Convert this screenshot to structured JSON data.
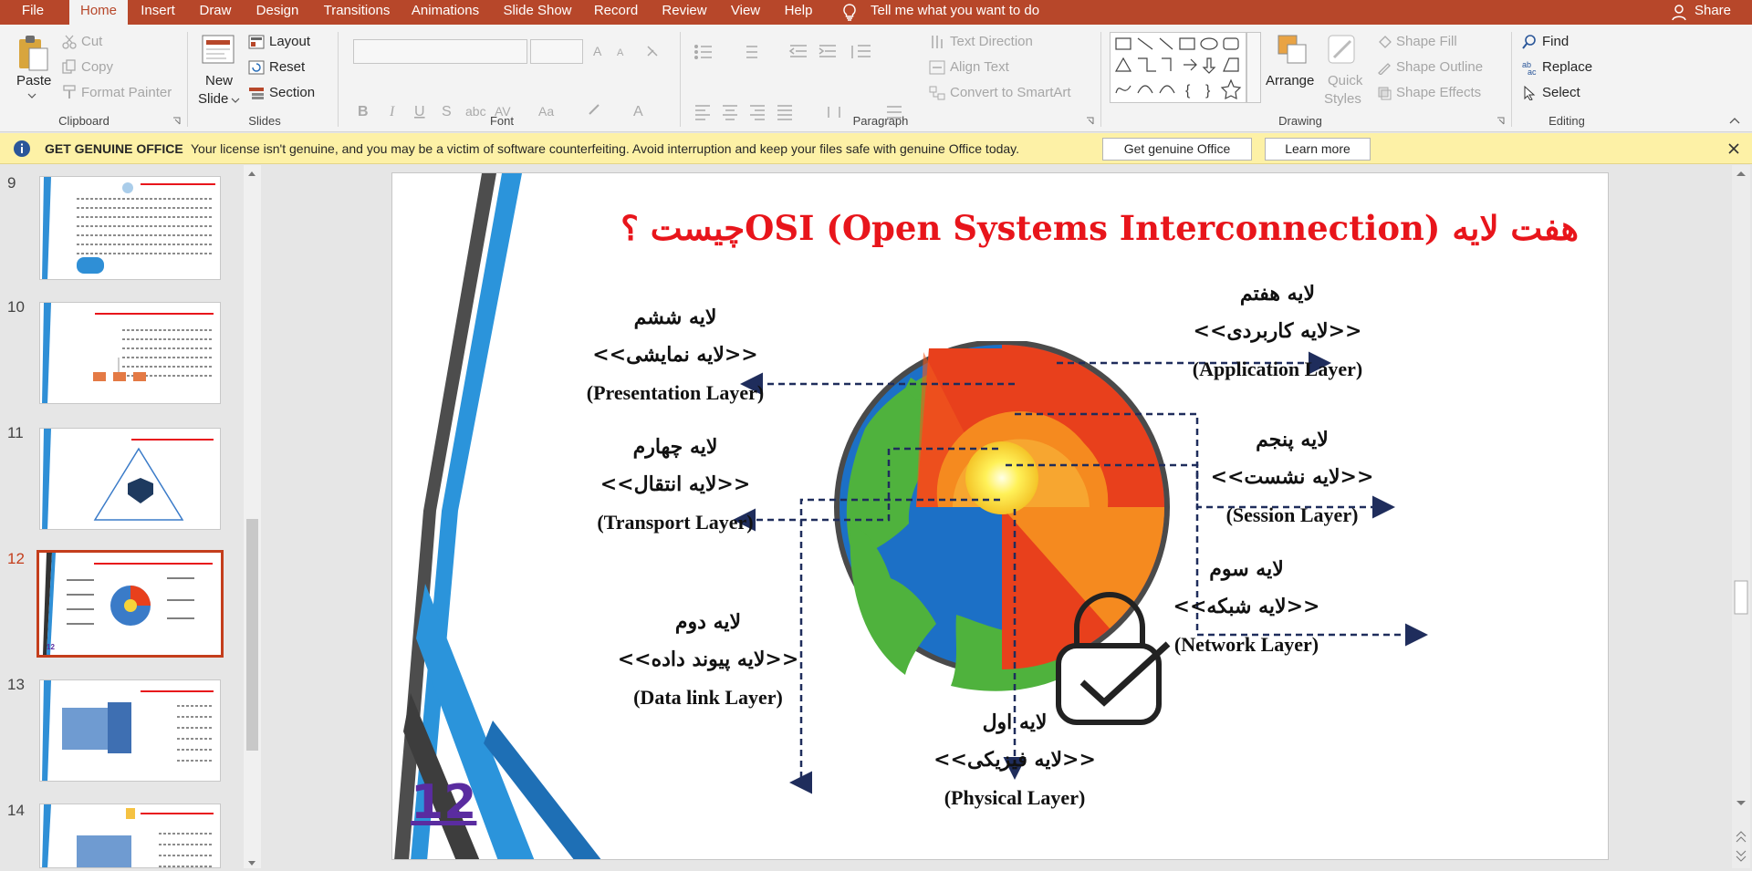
{
  "tabs": [
    "File",
    "Home",
    "Insert",
    "Draw",
    "Design",
    "Transitions",
    "Animations",
    "Slide Show",
    "Record",
    "Review",
    "View",
    "Help"
  ],
  "tell_me": "Tell me what you want to do",
  "share": "Share",
  "clipboard": {
    "paste": "Paste",
    "cut": "Cut",
    "copy": "Copy",
    "format_painter": "Format Painter",
    "label": "Clipboard"
  },
  "slides_grp": {
    "new_slide_1": "New",
    "new_slide_2": "Slide",
    "layout": "Layout",
    "reset": "Reset",
    "section": "Section",
    "label": "Slides"
  },
  "font_grp": {
    "label": "Font"
  },
  "paragraph_grp": {
    "text_direction": "Text Direction",
    "align_text": "Align Text",
    "convert_smartart": "Convert to SmartArt",
    "label": "Paragraph"
  },
  "drawing_grp": {
    "arrange": "Arrange",
    "quick_styles_1": "Quick",
    "quick_styles_2": "Styles",
    "shape_fill": "Shape Fill",
    "shape_outline": "Shape Outline",
    "shape_effects": "Shape Effects",
    "label": "Drawing"
  },
  "editing_grp": {
    "find": "Find",
    "replace": "Replace",
    "select": "Select",
    "label": "Editing"
  },
  "infobar": {
    "title": "GET GENUINE OFFICE",
    "message": "Your license isn't genuine, and you may be a victim of software counterfeiting. Avoid interruption and keep your files safe with genuine Office today.",
    "btn_get": "Get genuine Office",
    "btn_learn": "Learn more"
  },
  "thumbnails": [
    {
      "num": "9"
    },
    {
      "num": "10"
    },
    {
      "num": "11"
    },
    {
      "num": "12"
    },
    {
      "num": "13"
    },
    {
      "num": "14"
    }
  ],
  "slide": {
    "title": "هفت لایه OSI (Open Systems Interconnection)چیست ؟",
    "number": "12",
    "layers": [
      {
        "fa": "لایه هفتم",
        "fa2": "<<لایه کاربردی>>",
        "en": "(Application Layer)"
      },
      {
        "fa": "لایه ششم",
        "fa2": "<<لایه نمایشی>>",
        "en": "(Presentation Layer)"
      },
      {
        "fa": "لایه پنجم",
        "fa2": "<<لایه نشست>>",
        "en": "(Session Layer)"
      },
      {
        "fa": "لایه چهارم",
        "fa2": "<<لایه انتقال>>",
        "en": "(Transport Layer)"
      },
      {
        "fa": "لایه سوم",
        "fa2": "<<لایه شبکه>>",
        "en": "(Network Layer)"
      },
      {
        "fa": "لایه دوم",
        "fa2": "<<لایه پیوند داده>>",
        "en": "(Data link Layer)"
      },
      {
        "fa": "لایه اول",
        "fa2": "<<لایه فیزیکی>>",
        "en": "(Physical Layer)"
      }
    ]
  },
  "colors": {
    "accent": "#b7472a",
    "title_red": "#e8151b",
    "slide_number": "#5a2ca0",
    "arrow": "#1f2d5c"
  }
}
